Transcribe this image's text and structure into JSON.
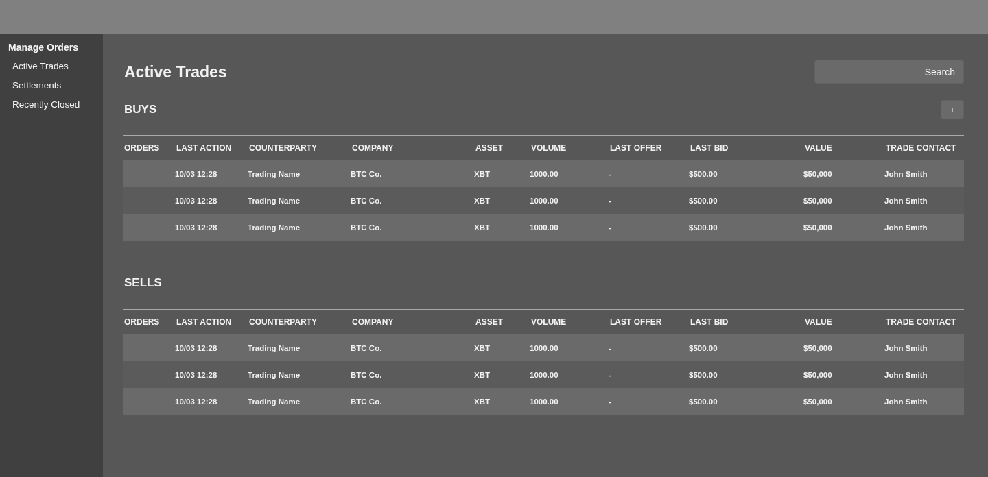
{
  "sidebar": {
    "heading": "Manage Orders",
    "items": [
      {
        "label": "Active Trades"
      },
      {
        "label": "Settlements"
      },
      {
        "label": "Recently Closed"
      }
    ]
  },
  "page_title": "Active Trades",
  "search": {
    "placeholder": "Search"
  },
  "sections": [
    {
      "title": "BUYS",
      "add_button": "+",
      "columns": [
        "ORDERS",
        "LAST ACTION",
        "COUNTERPARTY",
        "COMPANY",
        "ASSET",
        "VOLUME",
        "LAST OFFER",
        "LAST BID",
        "VALUE",
        "TRADE CONTACT"
      ],
      "rows": [
        {
          "last_action": "10/03 12:28",
          "counterparty": "Trading Name",
          "company": "BTC Co.",
          "asset": "XBT",
          "volume": "1000.00",
          "last_offer": "-",
          "last_bid": "$500.00",
          "value": "$50,000",
          "trade_contact": "John Smith"
        },
        {
          "last_action": "10/03 12:28",
          "counterparty": "Trading Name",
          "company": "BTC Co.",
          "asset": "XBT",
          "volume": "1000.00",
          "last_offer": "-",
          "last_bid": "$500.00",
          "value": "$50,000",
          "trade_contact": "John Smith"
        },
        {
          "last_action": "10/03 12:28",
          "counterparty": "Trading Name",
          "company": "BTC Co.",
          "asset": "XBT",
          "volume": "1000.00",
          "last_offer": "-",
          "last_bid": "$500.00",
          "value": "$50,000",
          "trade_contact": "John Smith"
        }
      ]
    },
    {
      "title": "SELLS",
      "columns": [
        "ORDERS",
        "LAST ACTION",
        "COUNTERPARTY",
        "COMPANY",
        "ASSET",
        "VOLUME",
        "LAST OFFER",
        "LAST BID",
        "VALUE",
        "TRADE CONTACT"
      ],
      "rows": [
        {
          "last_action": "10/03 12:28",
          "counterparty": "Trading Name",
          "company": "BTC Co.",
          "asset": "XBT",
          "volume": "1000.00",
          "last_offer": "-",
          "last_bid": "$500.00",
          "value": "$50,000",
          "trade_contact": "John Smith"
        },
        {
          "last_action": "10/03 12:28",
          "counterparty": "Trading Name",
          "company": "BTC Co.",
          "asset": "XBT",
          "volume": "1000.00",
          "last_offer": "-",
          "last_bid": "$500.00",
          "value": "$50,000",
          "trade_contact": "John Smith"
        },
        {
          "last_action": "10/03 12:28",
          "counterparty": "Trading Name",
          "company": "BTC Co.",
          "asset": "XBT",
          "volume": "1000.00",
          "last_offer": "-",
          "last_bid": "$500.00",
          "value": "$50,000",
          "trade_contact": "John Smith"
        }
      ]
    }
  ]
}
